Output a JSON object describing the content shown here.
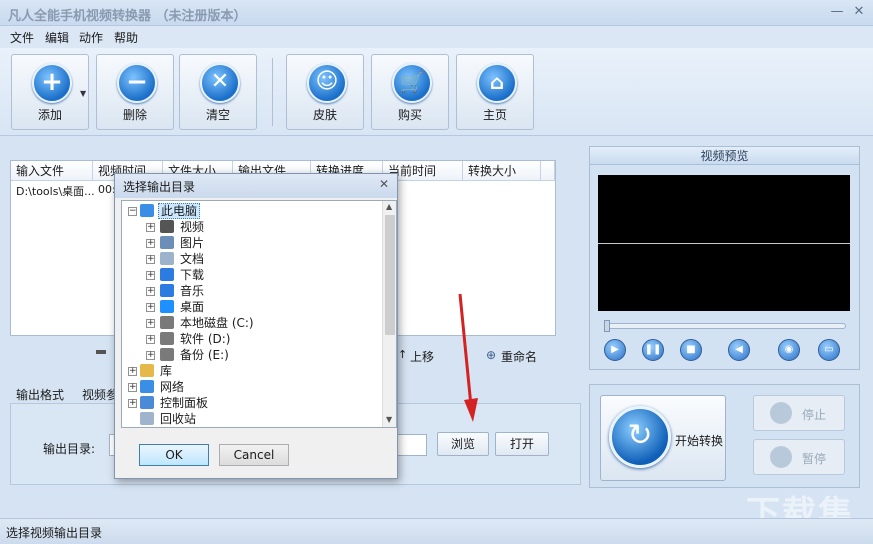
{
  "window": {
    "title": "凡人全能手机视频转换器 （未注册版本）",
    "min_label": "—",
    "close_label": "✕"
  },
  "menu": [
    "文件",
    "编辑",
    "动作",
    "帮助"
  ],
  "toolbar": {
    "add": "添加",
    "delete": "删除",
    "clear": "清空",
    "skin": "皮肤",
    "buy": "购买",
    "home": "主页"
  },
  "filelist": {
    "columns": [
      "输入文件",
      "视频时间",
      "文件大小",
      "输出文件",
      "转换进度",
      "当前时间",
      "转换大小"
    ],
    "rows": [
      {
        "input": "D:\\tools\\桌面...",
        "duration": "00:"
      }
    ]
  },
  "list_actions": {
    "move": "上移",
    "rename": "重命名"
  },
  "tabs": [
    "输出格式",
    "视频参"
  ],
  "output": {
    "dir_label": "输出目录:",
    "browse": "浏览",
    "open": "打开"
  },
  "preview": {
    "title": "视频预览"
  },
  "convert": {
    "start": "开始转换",
    "stop": "停止",
    "pause": "暂停"
  },
  "dialog": {
    "title": "选择输出目录",
    "close": "✕",
    "ok": "OK",
    "cancel": "Cancel",
    "tree": [
      {
        "label": "此电脑",
        "level": 0,
        "icon": "computer-icon",
        "selected": true
      },
      {
        "label": "视频",
        "level": 1,
        "icon": "video-folder-icon"
      },
      {
        "label": "图片",
        "level": 1,
        "icon": "pictures-folder-icon"
      },
      {
        "label": "文档",
        "level": 1,
        "icon": "documents-folder-icon"
      },
      {
        "label": "下载",
        "level": 1,
        "icon": "download-arrow-icon"
      },
      {
        "label": "音乐",
        "level": 1,
        "icon": "music-note-icon"
      },
      {
        "label": "桌面",
        "level": 1,
        "icon": "desktop-icon"
      },
      {
        "label": "本地磁盘 (C:)",
        "level": 1,
        "icon": "drive-icon"
      },
      {
        "label": "软件 (D:)",
        "level": 1,
        "icon": "drive-icon"
      },
      {
        "label": "备份 (E:)",
        "level": 1,
        "icon": "drive-icon"
      },
      {
        "label": "库",
        "level": 0,
        "icon": "library-icon"
      },
      {
        "label": "网络",
        "level": 0,
        "icon": "network-icon"
      },
      {
        "label": "控制面板",
        "level": 0,
        "icon": "control-panel-icon"
      },
      {
        "label": "回收站",
        "level": 0,
        "icon": "recycle-bin-icon"
      }
    ]
  },
  "status": {
    "text": "选择视频输出目录"
  },
  "watermark": "下载集"
}
